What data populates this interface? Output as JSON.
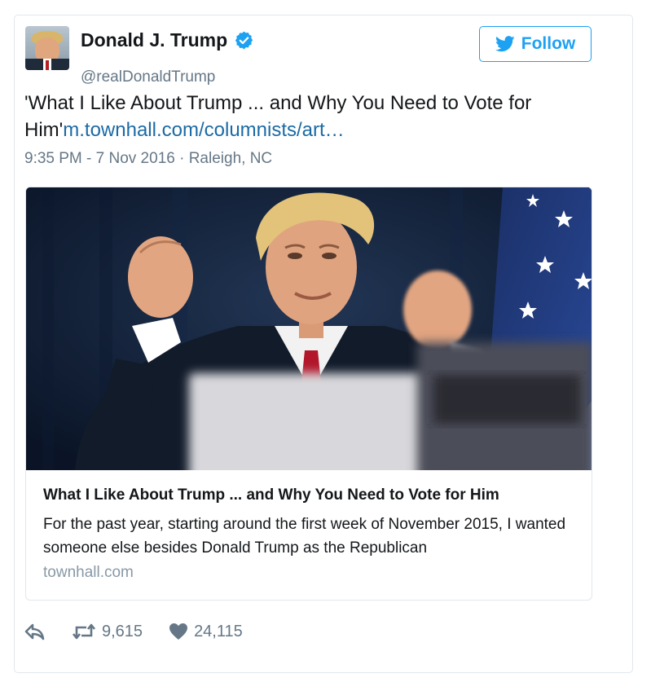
{
  "user": {
    "name": "Donald J. Trump",
    "handle": "@realDonaldTrump",
    "verified_icon": "verified-badge-icon"
  },
  "follow_button": {
    "label": "Follow",
    "icon": "twitter-bird-icon"
  },
  "tweet": {
    "text_before_link": "'What I Like About Trump ... and Why You Need to Vote for Him'",
    "link_text": "m.townhall.com/columnists/art…",
    "timestamp": "9:35 PM - 7 Nov 2016 · Raleigh, NC"
  },
  "card": {
    "image_description_icon": "photo-image",
    "title": "What I Like About Trump ... and Why You Need to Vote for Him",
    "description": "For the past year, starting around the first week of November 2015, I wanted someone else besides Donald Trump as the Republican",
    "domain": "townhall.com"
  },
  "actions": {
    "reply_icon": "reply-icon",
    "retweet_icon": "retweet-icon",
    "retweets": "9,615",
    "like_icon": "heart-icon",
    "likes": "24,115"
  },
  "colors": {
    "accent": "#1da1f2",
    "link": "#1b6aa5",
    "secondary_text": "#657786",
    "border": "#e1e8ed"
  }
}
